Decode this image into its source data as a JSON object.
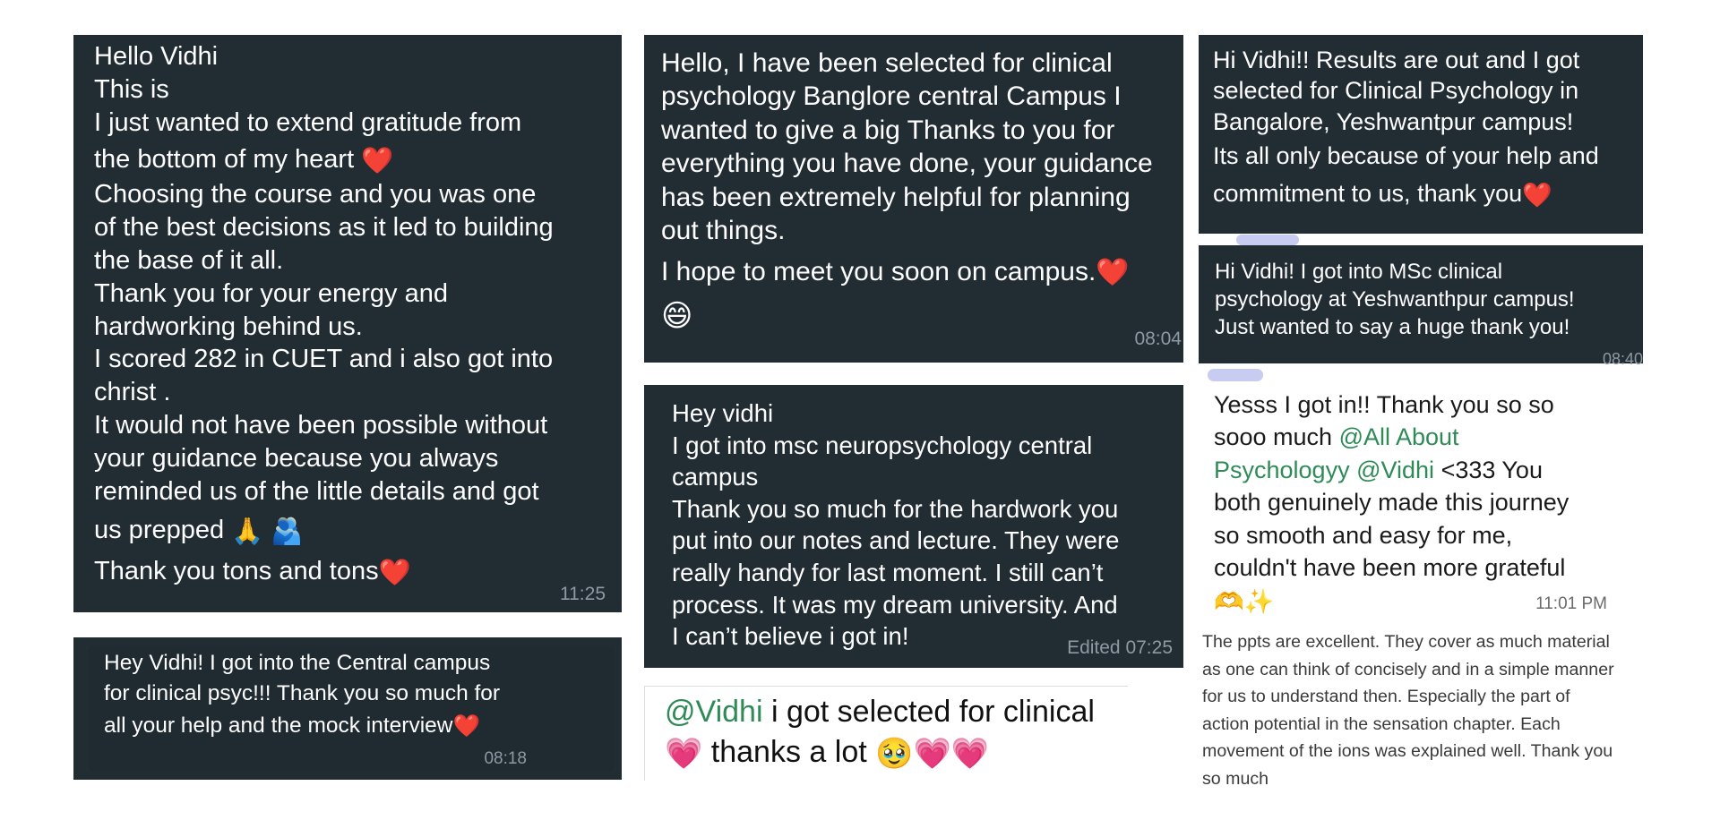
{
  "cards": [
    {
      "lines": [
        "Hello Vidhi",
        "This is",
        "I just wanted to extend gratitude from",
        "the bottom of my heart",
        "Choosing the course and you was one",
        "of the best decisions as it led to building",
        "the base of it all.",
        "Thank you for your energy and",
        "hardworking behind us.",
        "I scored 282 in CUET and i also got into",
        "christ .",
        "It would not have been possible without",
        "your guidance because you always",
        "reminded us of the little details and got",
        "us prepped",
        "Thank you tons and tons"
      ],
      "time": "11:25"
    },
    {
      "lines": [
        "Hey Vidhi! I got into the Central campus",
        "for clinical psyc!!! Thank you so much for",
        "all your help and the mock interview"
      ],
      "time": "08:18"
    },
    {
      "lines": [
        "Hello, I have been selected for clinical",
        "psychology Banglore central Campus I",
        "wanted to give a big Thanks to you for",
        "everything you have done, your guidance",
        "has been extremely helpful for planning",
        "out things.",
        "I hope to meet you soon on campus."
      ],
      "time": "08:04"
    },
    {
      "lines": [
        "Hey vidhi",
        "I got into msc neuropsychology central",
        "campus",
        "Thank you so much for the hardwork you",
        "put into our notes and lecture. They were",
        "really handy for last moment. I still can’t",
        "process. It was my dream university. And",
        "I can’t believe i got in!"
      ],
      "time": "Edited 07:25"
    },
    {
      "mention": "@Vidhi",
      "line1": " i got selected for clinical",
      "line2": "thanks a lot"
    },
    {
      "lines": [
        "Hi Vidhi!! Results are out and I got",
        "selected for Clinical Psychology in",
        "Bangalore, Yeshwantpur campus!",
        "Its all only because of your help and",
        "commitment to us, thank you"
      ]
    },
    {
      "lines": [
        "Hi Vidhi! I got into MSc clinical",
        "psychology at Yeshwanthpur campus!",
        "Just wanted to say a huge thank you!"
      ],
      "time": "08:40"
    },
    {
      "line1": "Yesss I got in!! Thank you so so",
      "line2a": "sooo much ",
      "mention1a": "@All About",
      "mention1b": "Psychologyy",
      "mention2": "@Vidhi",
      "line3a": " <333 You",
      "line4": "both genuinely made this journey",
      "line5": "so smooth and easy for me,",
      "line6": "couldn't have been more grateful",
      "time": "11:01 PM"
    },
    {
      "lines": [
        "The ppts are excellent. They cover as much material",
        "as one can think of concisely and in a simple manner",
        "for us to understand then. Especially the part of",
        "action potential in the sensation chapter. Each",
        "movement of the ions was explained well. Thank you",
        "so much"
      ]
    }
  ],
  "emoji": {
    "heart": "❤️",
    "folded_hands": "🙏",
    "hug": "🫂",
    "grin": "😄",
    "pink_heart": "💗",
    "pleading": "🥹",
    "heart_hands": "🫶",
    "sparkles": "✨"
  },
  "colors": {
    "bubble_dark": "#222c33",
    "mention_green": "#2e8b57",
    "timestamp": "#8e9aa3"
  }
}
